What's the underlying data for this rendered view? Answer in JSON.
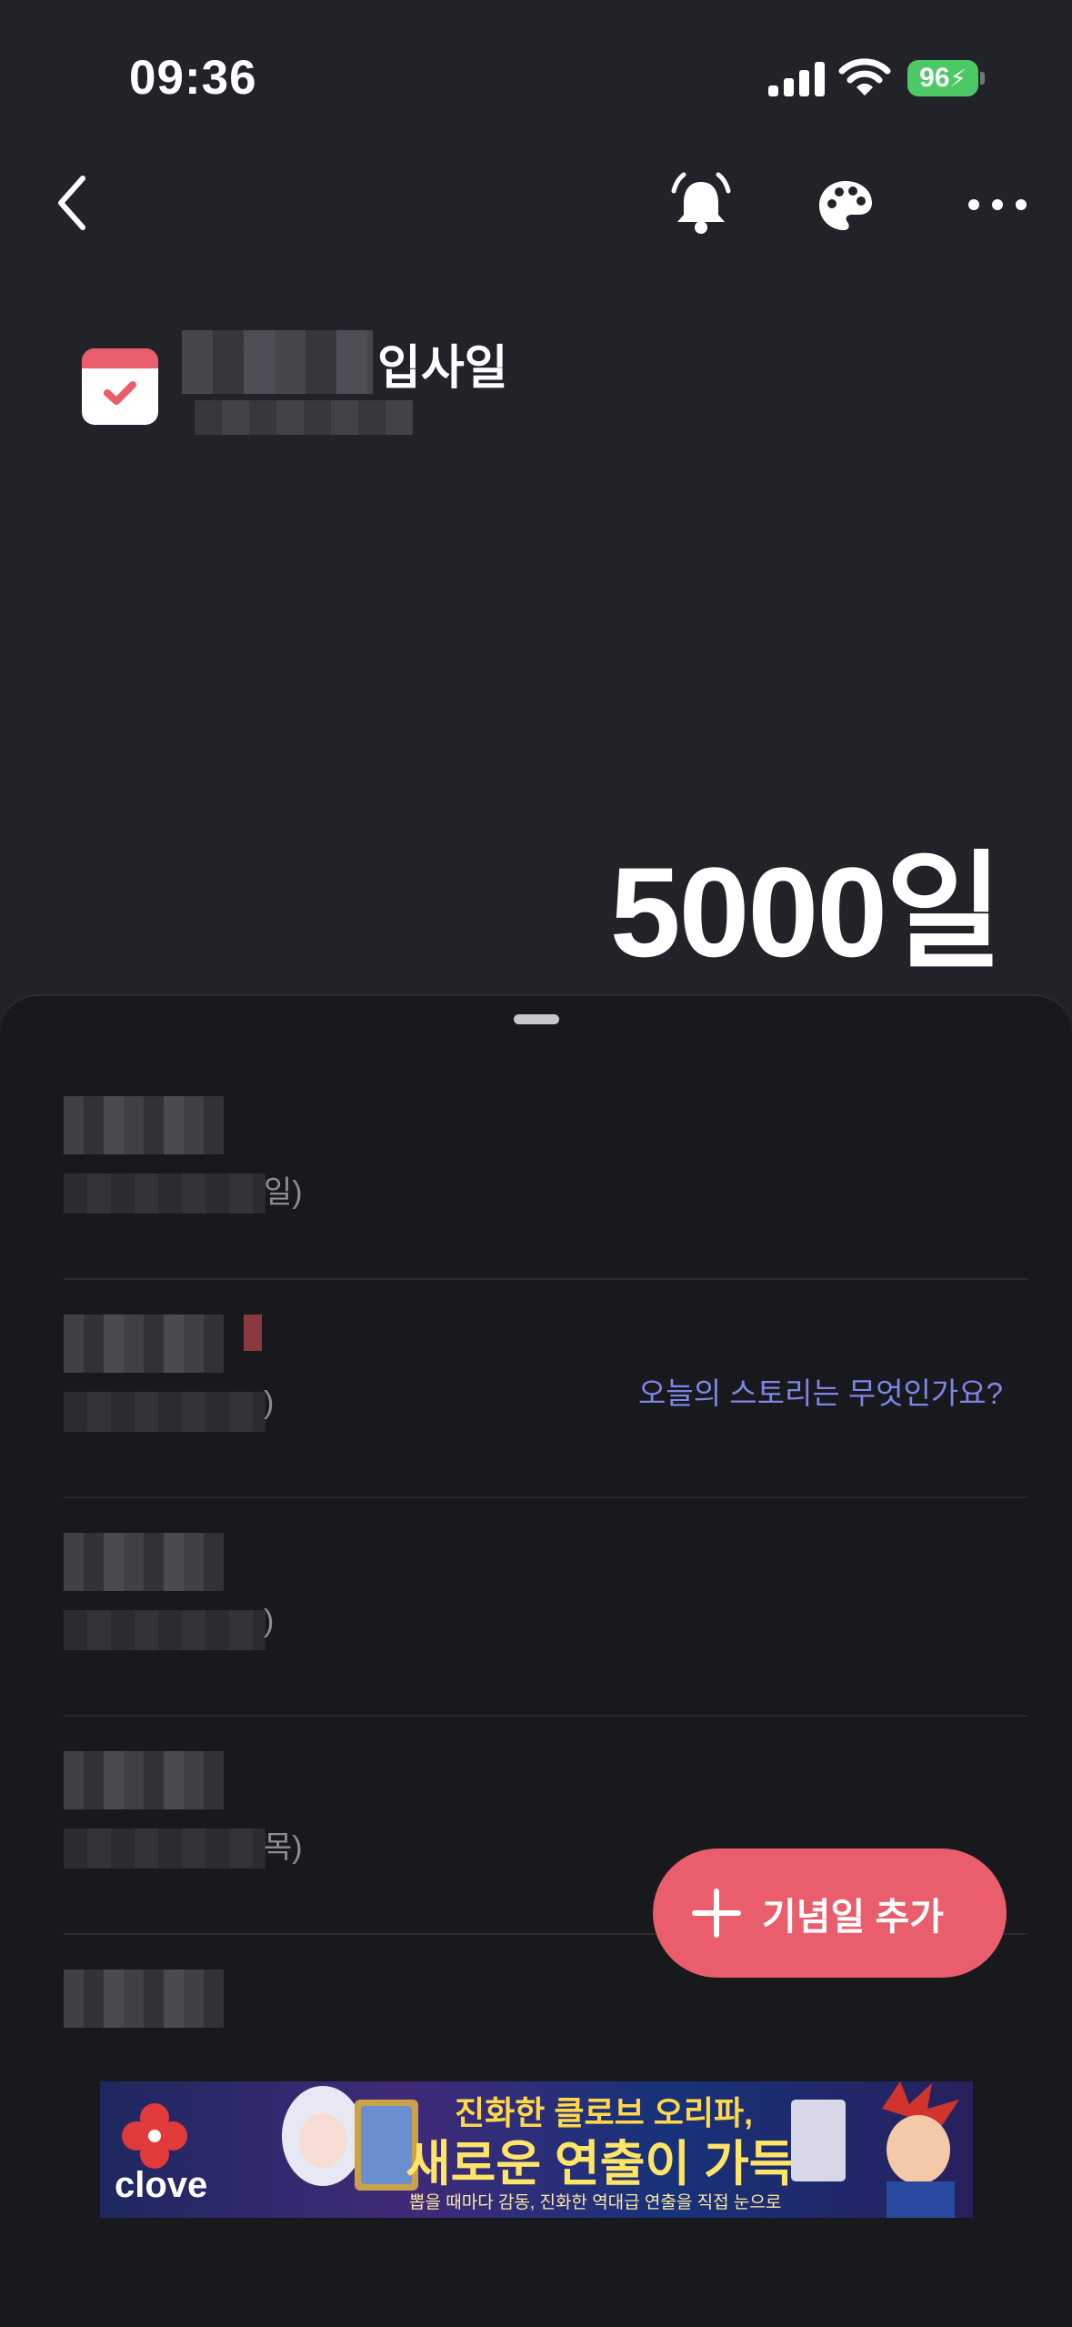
{
  "status_bar": {
    "time": "09:36",
    "battery": "96"
  },
  "nav": {
    "back": "back",
    "bell": "notification",
    "palette": "theme",
    "more": "more"
  },
  "event": {
    "title": "입사일"
  },
  "counter": {
    "value": "5000일"
  },
  "list": {
    "rows": [
      {
        "suffix": "일)",
        "story": ""
      },
      {
        "suffix": ")",
        "story": "오늘의 스토리는 무엇인가요?"
      },
      {
        "suffix": ")",
        "story": ""
      },
      {
        "suffix": "목)",
        "story": ""
      },
      {
        "suffix": "",
        "story": ""
      }
    ]
  },
  "fab": {
    "label": "기념일 추가"
  },
  "ad": {
    "brand": "clove",
    "headline1": "진화한 클로브 오리파,",
    "headline2": "새로운 연출이 가득!",
    "sub": "뽑을 때마다 감동, 진화한 역대급 연출을 직접 눈으로"
  },
  "colors": {
    "background": "#222328",
    "sheet": "#18191d",
    "accent": "#ea5d6c",
    "link": "#7d86e8"
  }
}
